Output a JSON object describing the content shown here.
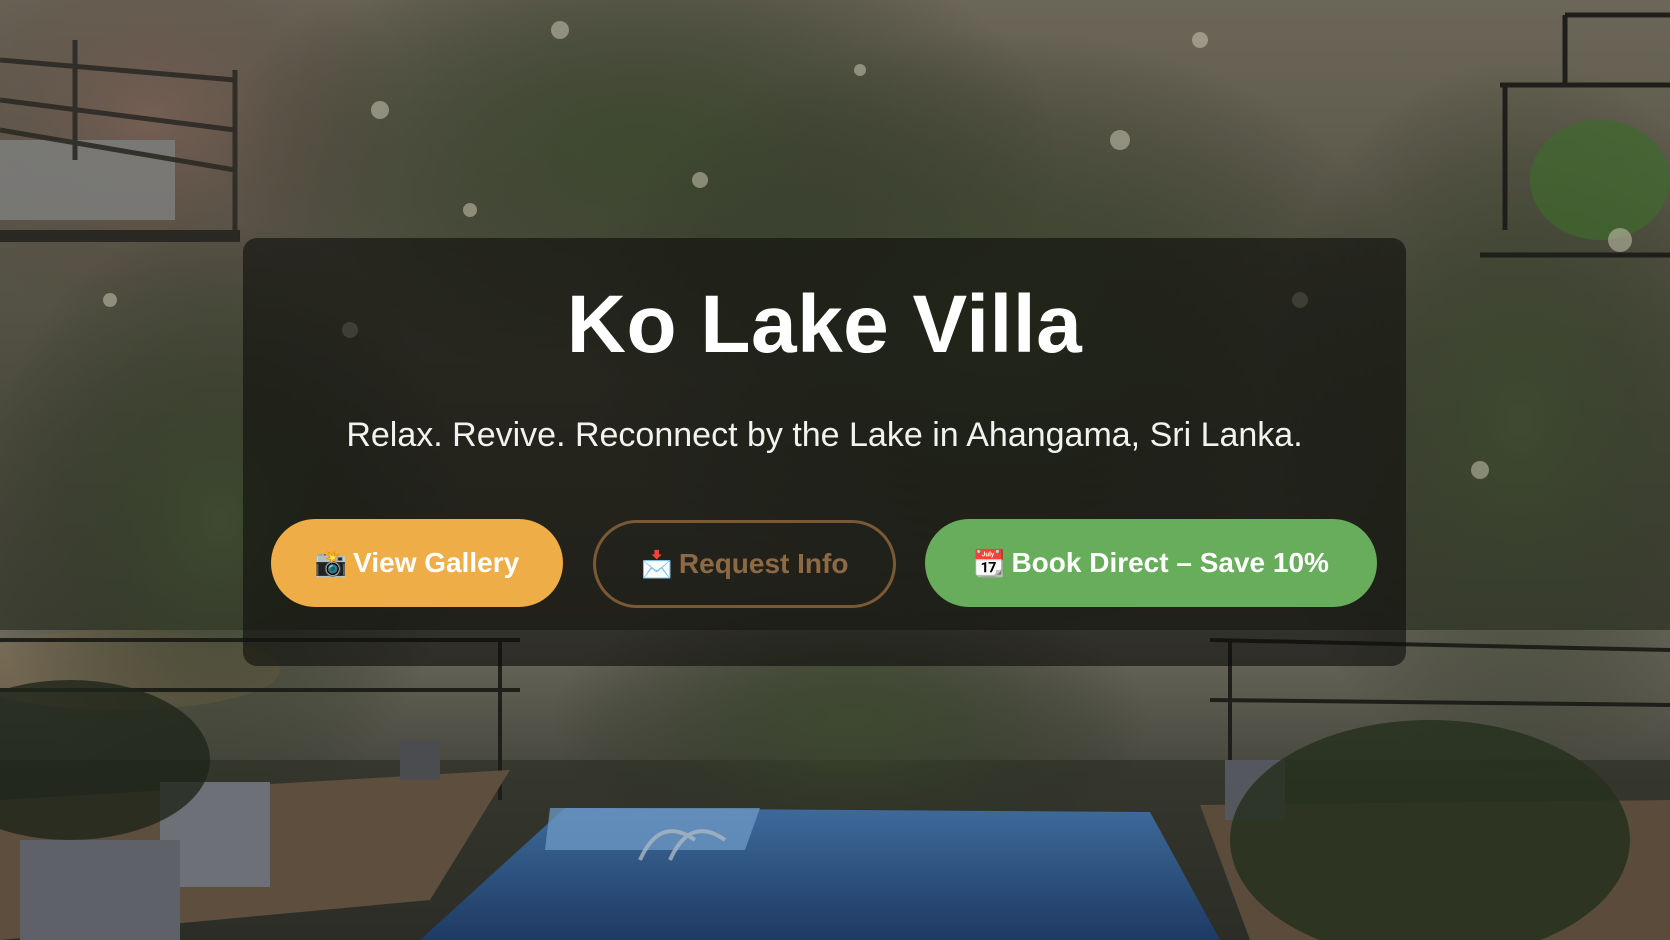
{
  "hero": {
    "title": "Ko Lake Villa",
    "tagline": "Relax. Revive. Reconnect by the Lake in Ahangama, Sri Lanka."
  },
  "buttons": {
    "gallery": {
      "icon": "📸",
      "icon_name": "camera-flash-icon",
      "label": "View Gallery",
      "color": "#efad48"
    },
    "info": {
      "icon": "📩",
      "icon_name": "envelope-arrow-icon",
      "label": "Request Info",
      "color": "#8d6a43"
    },
    "book": {
      "icon": "📆",
      "icon_name": "calendar-icon",
      "label": "Book Direct – Save 10%",
      "color": "#67ad5b"
    }
  }
}
